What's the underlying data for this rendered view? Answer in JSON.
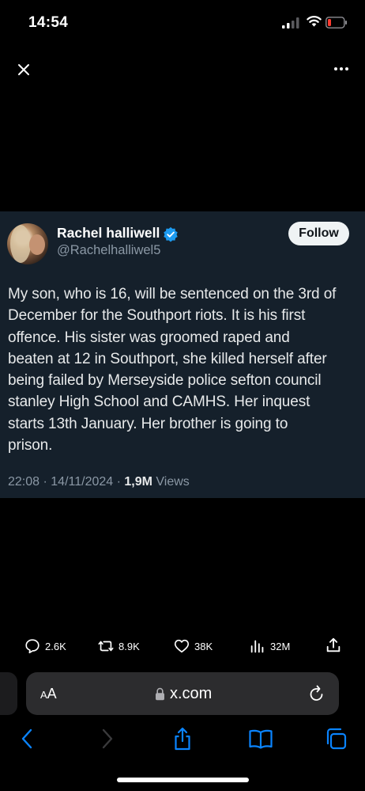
{
  "status_bar": {
    "time": "14:54"
  },
  "tweet": {
    "author_name": "Rachel halliwell",
    "author_handle": "@Rachelhalliwel5",
    "follow_label": "Follow",
    "text": "My son, who is 16, will be sentenced on the 3rd of\nDecember for the Southport riots. It is his first\noffence.   His sister was groomed raped and\nbeaten at 12 in Southport, she killed herself after\nbeing failed by Merseyside police sefton council\nstanley High School and CAMHS.  Her inquest\nstarts 13th January.  Her brother is going to\nprison.",
    "time": "22:08",
    "date": "14/11/2024",
    "views_count": "1,9M",
    "views_label": "Views"
  },
  "engagement": {
    "replies": "2.6K",
    "reposts": "8.9K",
    "likes": "38K",
    "views": "32M"
  },
  "browser": {
    "aa_label_big": "A",
    "aa_label_small": "A",
    "url": "x.com"
  },
  "colors": {
    "card_bg": "#15202b",
    "verified": "#1d9bf0",
    "toolbar_accent": "#0a84ff",
    "secondary_text": "#8b98a5"
  },
  "icons": {
    "close": "close-icon",
    "more": "more-horizontal-icon",
    "verified": "verified-badge-icon",
    "reply": "reply-icon",
    "repost": "repost-icon",
    "like": "heart-icon",
    "views": "views-icon",
    "share": "share-icon",
    "lock": "lock-icon",
    "reload": "reload-icon",
    "back": "back-icon",
    "forward": "forward-icon",
    "bookmarks": "bookmarks-icon",
    "tabs": "tabs-icon"
  }
}
